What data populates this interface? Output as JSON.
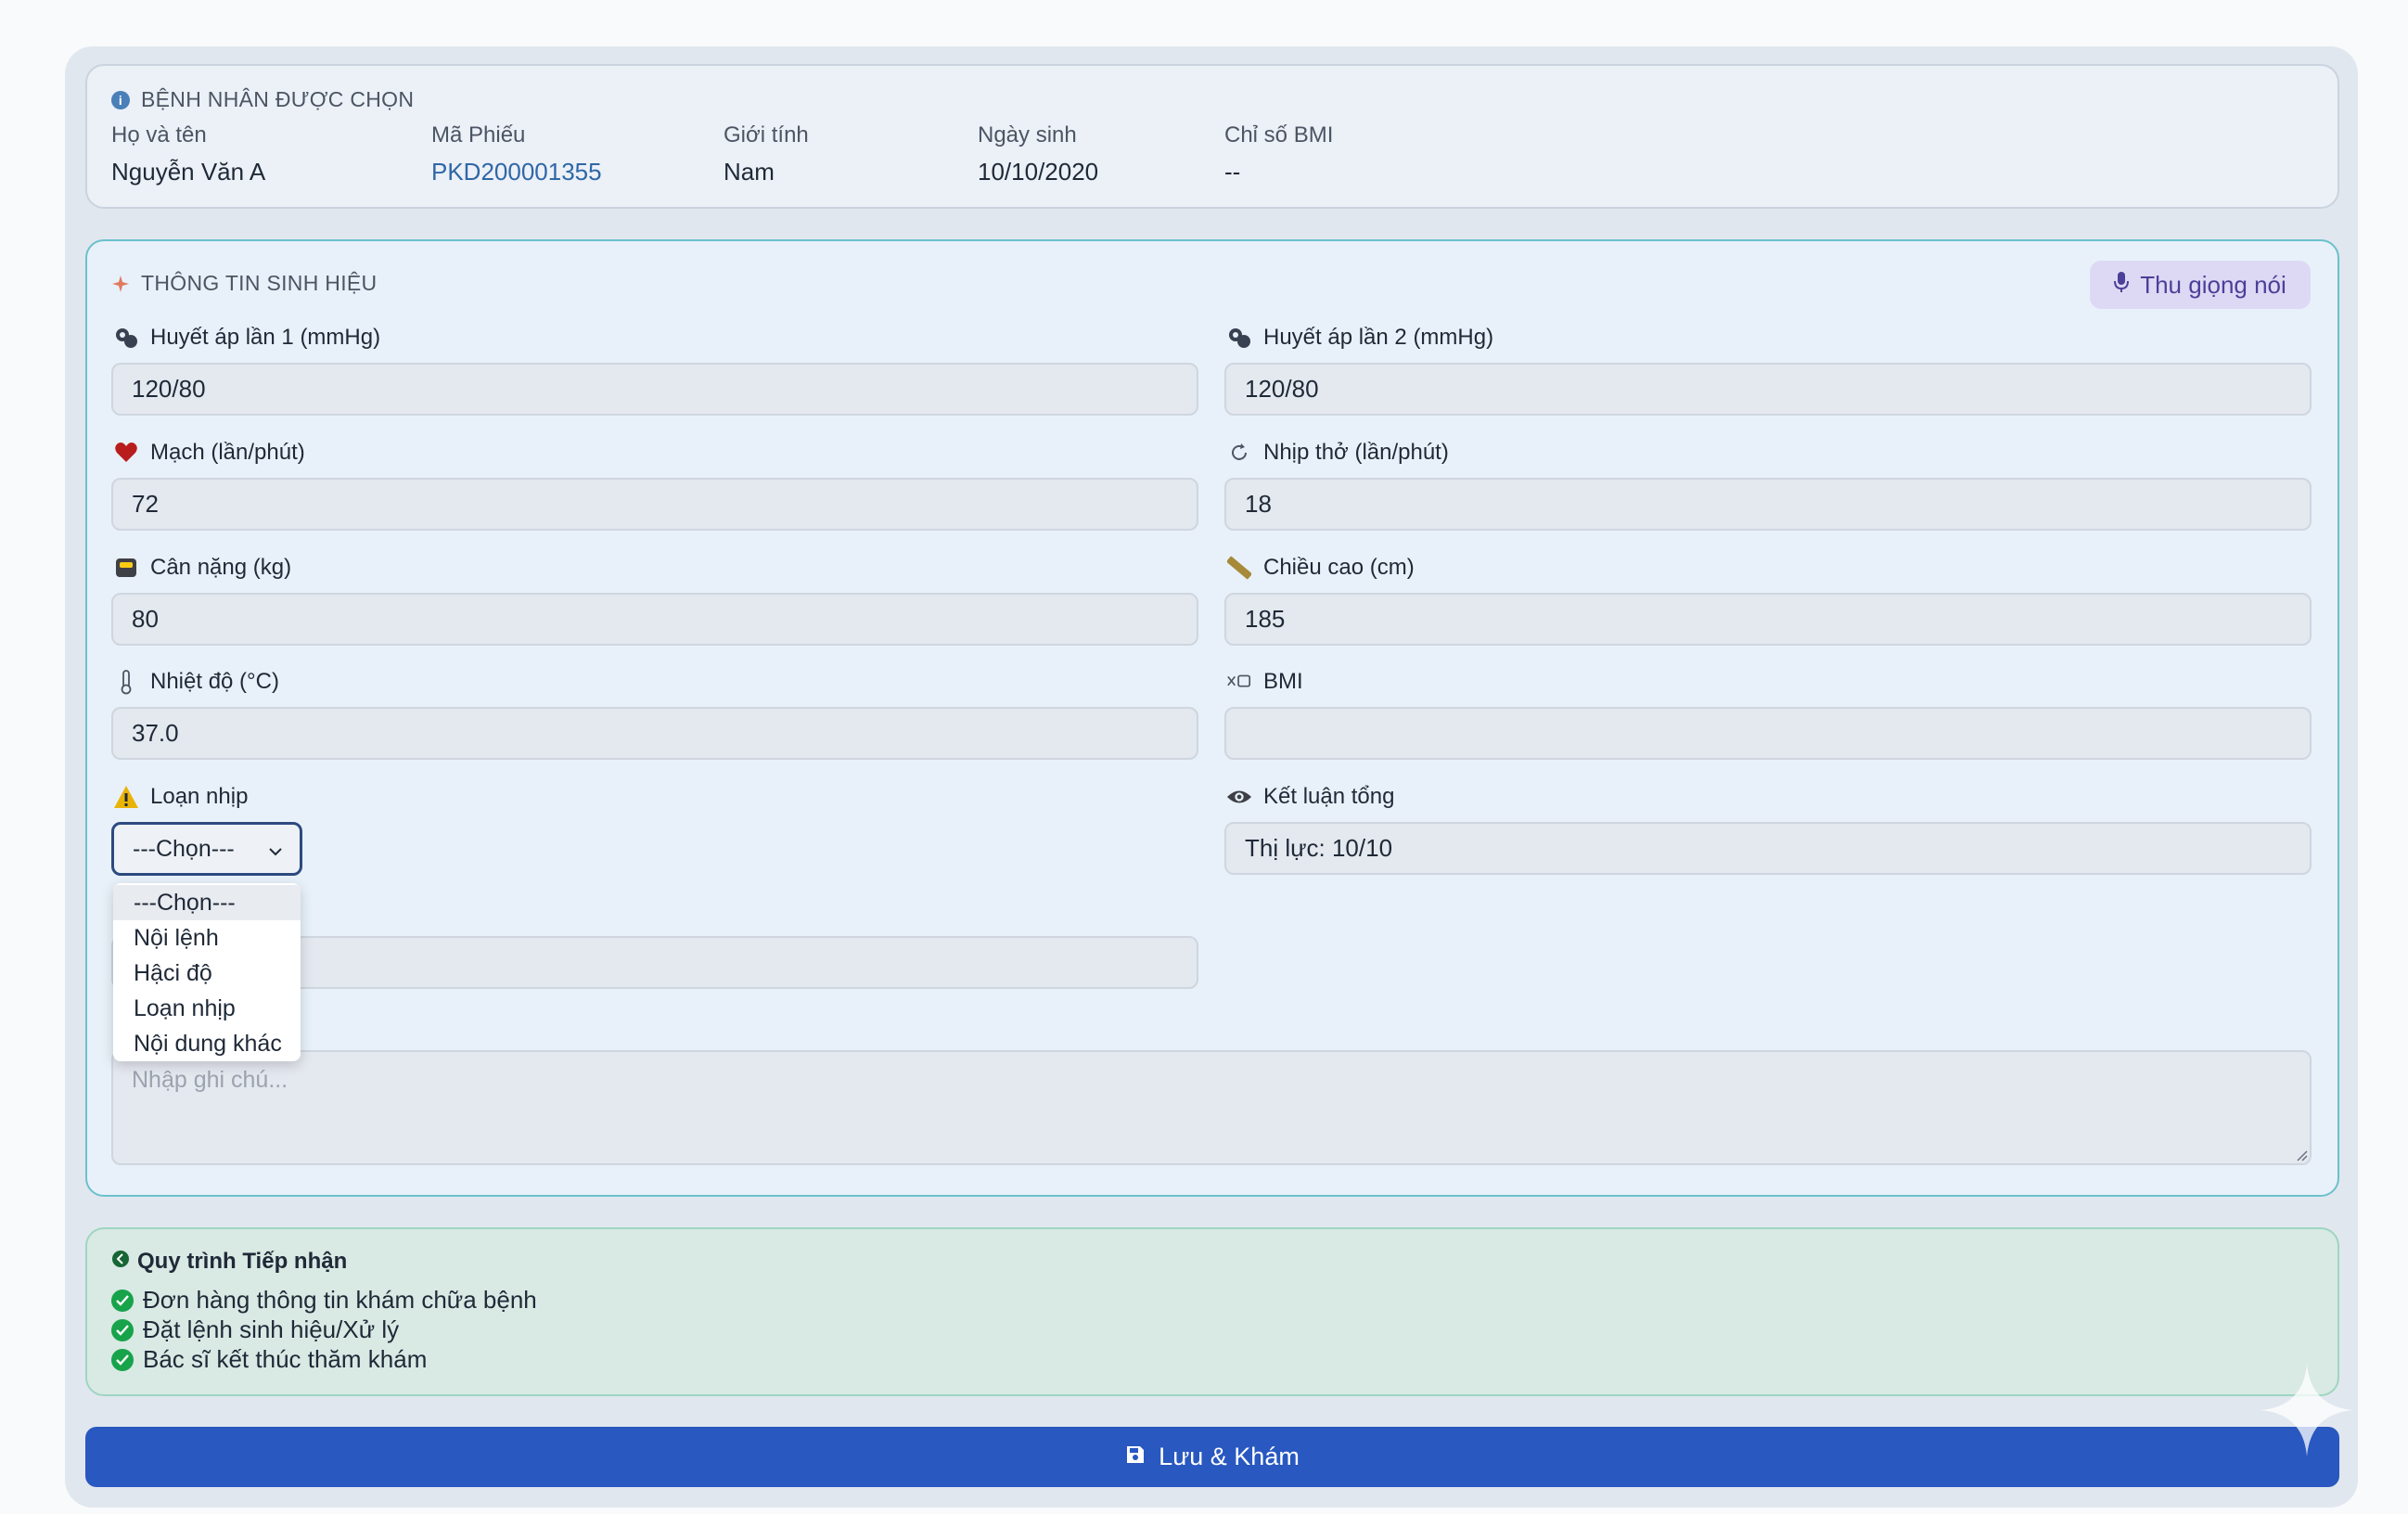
{
  "patient": {
    "section_title": "BỆNH NHÂN ĐƯỢC CHỌN",
    "fields": [
      {
        "label": "Họ và tên",
        "value": "Nguyễn Văn A"
      },
      {
        "label": "Mã Phiếu",
        "value": "PKD200001355"
      },
      {
        "label": "Giới tính",
        "value": "Nam"
      },
      {
        "label": "Ngày sinh",
        "value": "10/10/2020"
      },
      {
        "label": "Chỉ số BMI",
        "value": "--"
      }
    ]
  },
  "vitals": {
    "section_title": "THÔNG TIN SINH HIỆU",
    "voice_button": "Thu giọng nói",
    "bp1": {
      "label": "Huyết áp lần 1 (mmHg)",
      "value": "120/80"
    },
    "bp2": {
      "label": "Huyết áp lần 2 (mmHg)",
      "value": "120/80"
    },
    "pulse": {
      "label": "Mạch (lần/phút)",
      "value": "72"
    },
    "resp": {
      "label": "Nhịp thở (lần/phút)",
      "value": "18"
    },
    "weight": {
      "label": "Cân nặng (kg)",
      "value": "80"
    },
    "height": {
      "label": "Chiều cao (cm)",
      "value": "185"
    },
    "temp": {
      "label": "Nhiệt độ (°C)",
      "value": "37.0"
    },
    "bmi": {
      "label": "BMI",
      "value": ""
    },
    "arrhythmia": {
      "label": "Loạn nhịp",
      "selected": "---Chọn---",
      "options": [
        "---Chọn---",
        "Nội lệnh",
        "Hậci độ",
        "Loạn nhịp",
        "Nội dung khác"
      ]
    },
    "conclusion": {
      "label": "Kết luận tổng",
      "value": "Thị lực: 10/10"
    },
    "note_placeholder": "Nhập ghi chú..."
  },
  "process": {
    "title": "Quy trình Tiếp nhận",
    "steps": [
      "Đơn hàng thông tin khám chữa bệnh",
      "Đặt lệnh sinh hiệu/Xử lý",
      "Bác sĩ kết thúc thăm khám"
    ]
  },
  "save_button": "Lưu & Khám",
  "colors": {
    "primary": "#2858c0",
    "accent": "#4c3f99",
    "success": "#17a34a",
    "link": "#2f67a6"
  }
}
